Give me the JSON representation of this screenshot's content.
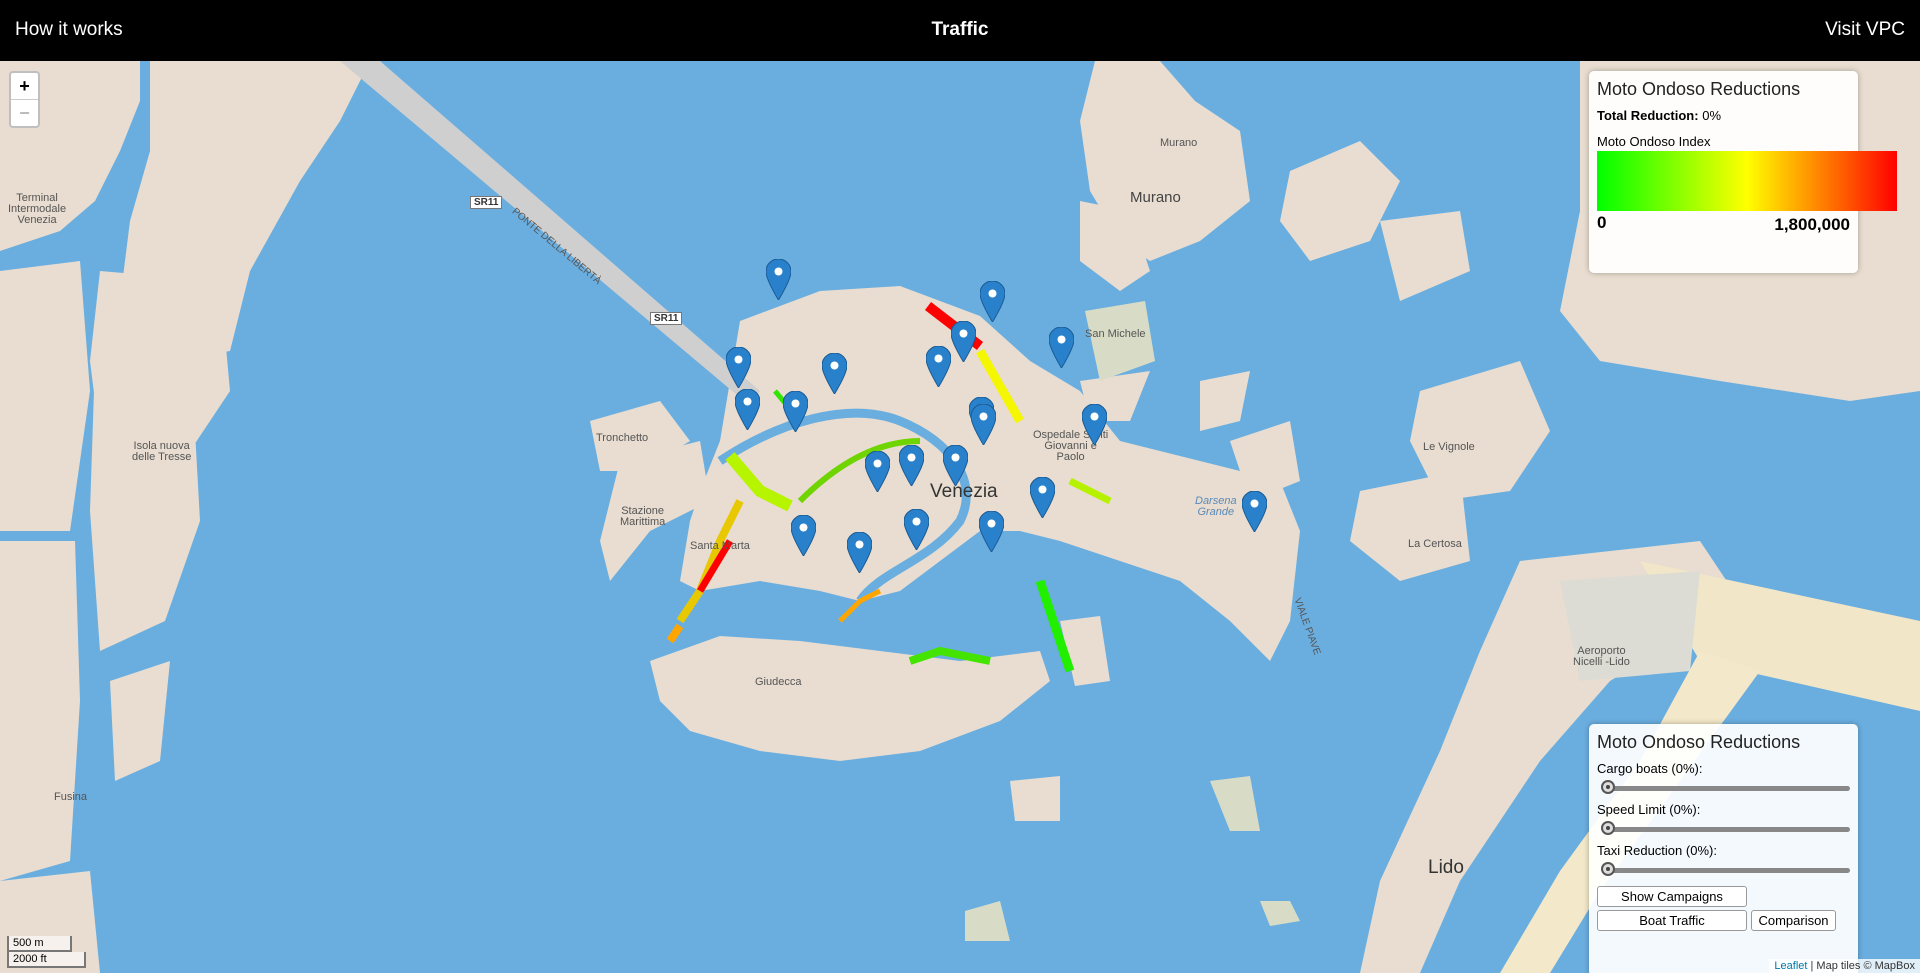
{
  "nav": {
    "left": "How it works",
    "title": "Traffic",
    "right": "Visit VPC"
  },
  "zoom": {
    "in": "+",
    "out": "−"
  },
  "legend": {
    "title": "Moto Ondoso Reductions",
    "total_label": "Total Reduction:",
    "total_value": "0%",
    "index_label": "Moto Ondoso Index",
    "min": "0",
    "max": "1,800,000",
    "colors": [
      "#00ff00",
      "#ffff00",
      "#ff0000"
    ]
  },
  "controls": {
    "title": "Moto Ondoso Reductions",
    "sliders": [
      {
        "label": "Cargo boats (0%):",
        "value": 0
      },
      {
        "label": "Speed Limit (0%):",
        "value": 0
      },
      {
        "label": "Taxi Reduction (0%):",
        "value": 0
      }
    ],
    "buttons": [
      "Show Campaigns",
      "Boat Traffic",
      "Comparison"
    ]
  },
  "scale": {
    "metric": "500 m",
    "imperial": "2000 ft"
  },
  "attribution": {
    "link": "Leaflet",
    "text": " | Map tiles © MapBox"
  },
  "map_labels": {
    "murano_small": "Murano",
    "murano": "Murano",
    "terminal": "Terminal\nIntermodale\nVenezia",
    "isola": "Isola nuova\ndelle Tresse",
    "tronchetto": "Tronchetto",
    "stazione": "Stazione\nMarittima",
    "santa_marta": "Santa Marta",
    "venezia": "Venezia",
    "giudecca": "Giudecca",
    "san_michele": "San Michele",
    "ospedale": "Ospedale Santi\nGiovanni e\nPaolo",
    "darsena": "Darsena\nGrande",
    "le_vignole": "Le Vignole",
    "la_certosa": "La Certosa",
    "aeroporto": "Aeroporto\nNicelli -Lido",
    "lido": "Lido",
    "fusina": "Fusina",
    "sr11_a": "SR11",
    "sr11_b": "SR11",
    "ponte": "PONTE DELLA LIBERTÀ",
    "viale": "VIALE PIAVE"
  },
  "marker_icon": "map-pin-icon"
}
